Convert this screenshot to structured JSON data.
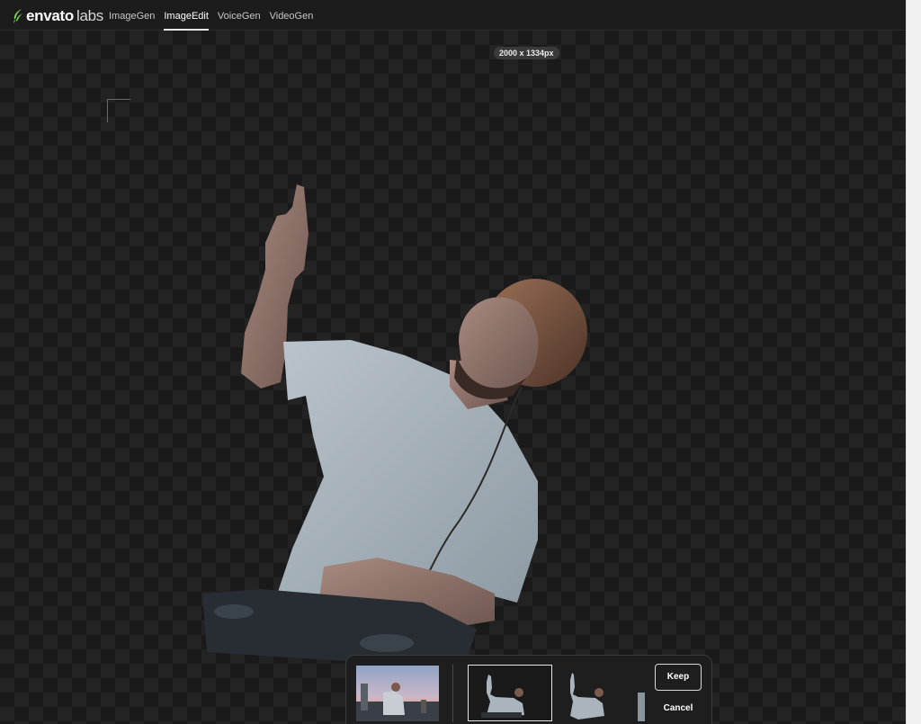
{
  "brand": {
    "name_bold": "envato",
    "name_light": "labs",
    "logo_color": "#7ed957"
  },
  "nav": {
    "tabs": [
      {
        "label": "ImageGen",
        "active": false
      },
      {
        "label": "ImageEdit",
        "active": true
      },
      {
        "label": "VoiceGen",
        "active": false
      },
      {
        "label": "VideoGen",
        "active": false
      }
    ]
  },
  "canvas": {
    "dimensions_label": "2000 x 1334px",
    "subject_icon": "person-cutout-image"
  },
  "tray": {
    "keep_label": "Keep",
    "cancel_label": "Cancel",
    "selected_variant": 1
  }
}
